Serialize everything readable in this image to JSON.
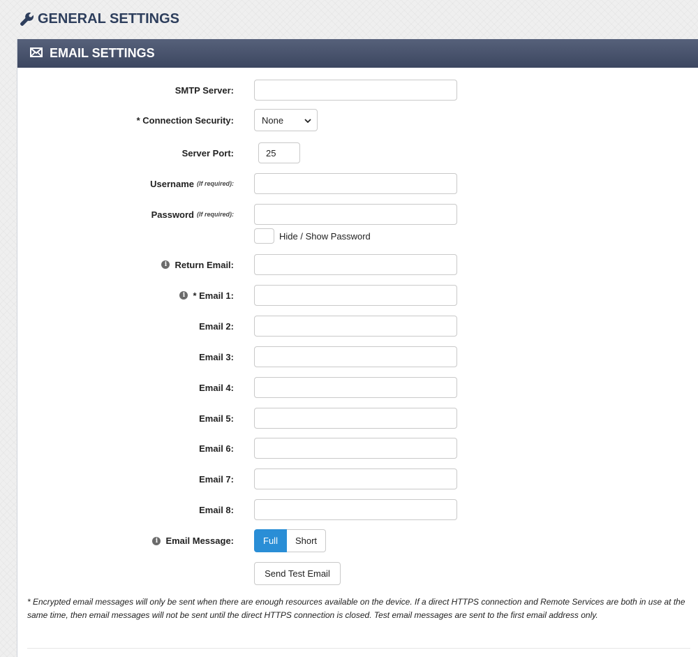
{
  "header": {
    "title": "GENERAL SETTINGS",
    "icon": "wrench-icon"
  },
  "panel": {
    "title": "EMAIL SETTINGS",
    "icon": "envelope-icon"
  },
  "fields": {
    "smtp_server": {
      "label": "SMTP Server:",
      "value": ""
    },
    "connection_security": {
      "label": "* Connection Security:",
      "value": "None"
    },
    "server_port": {
      "label": "Server Port:",
      "value": "25"
    },
    "username": {
      "label": "Username",
      "note": "(If required):",
      "value": ""
    },
    "password": {
      "label": "Password",
      "note": "(If required):",
      "value": ""
    },
    "show_password": {
      "label": "Hide / Show Password"
    },
    "return_email": {
      "label": "Return Email:",
      "value": ""
    },
    "emails": [
      {
        "label": "* Email 1:",
        "value": "",
        "info": true
      },
      {
        "label": "Email 2:",
        "value": ""
      },
      {
        "label": "Email 3:",
        "value": ""
      },
      {
        "label": "Email 4:",
        "value": ""
      },
      {
        "label": "Email 5:",
        "value": ""
      },
      {
        "label": "Email 6:",
        "value": ""
      },
      {
        "label": "Email 7:",
        "value": ""
      },
      {
        "label": "Email 8:",
        "value": ""
      }
    ],
    "email_message": {
      "label": "Email Message:",
      "options": [
        "Full",
        "Short"
      ],
      "selected": "Full"
    }
  },
  "actions": {
    "send_test": "Send Test Email"
  },
  "footnote": "* Encrypted email messages will only be sent when there are enough resources available on the device. If a direct HTTPS connection and Remote Services are both in use at the same time, then email messages will not be sent until the direct HTTPS connection is closed. Test email messages are sent to the first email address only.",
  "colors": {
    "header_text": "#2d3e5c",
    "panel_header": "#4a5470",
    "toggle_active": "#2a8ed6"
  }
}
